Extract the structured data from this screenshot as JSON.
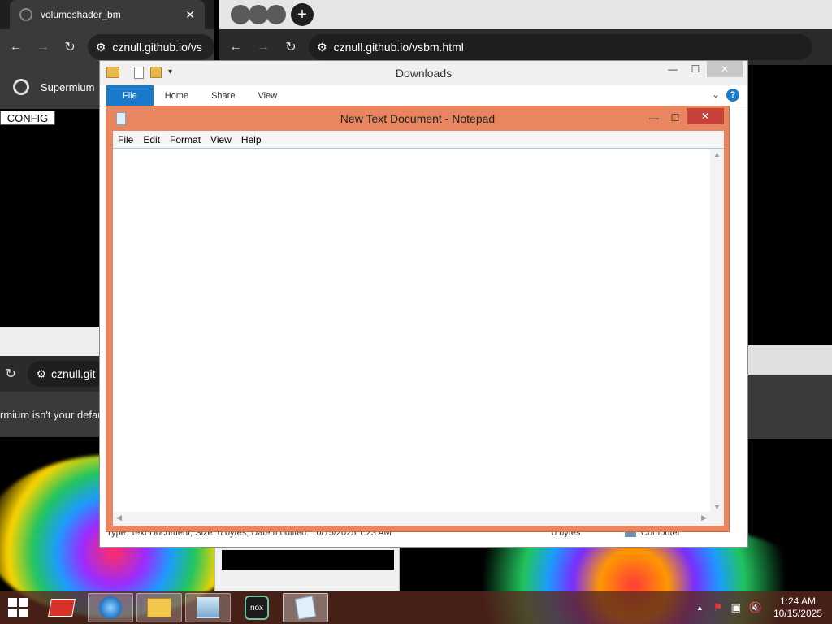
{
  "browser_left": {
    "tab_title": "volumeshader_bm",
    "url": "cznull.github.io/vs",
    "bookmark_label": "Supermium",
    "config_button": "CONFIG"
  },
  "browser_right": {
    "url": "cznull.github.io/vsbm.html"
  },
  "browser_lower": {
    "url": "cznull.git",
    "infobar_text": "rmium isn't your defau"
  },
  "explorer": {
    "title": "Downloads",
    "ribbon_tabs": [
      "File",
      "Home",
      "Share",
      "View"
    ],
    "status_left": "Type: Text Document, Size: 0 bytes, Date modified: 10/15/2025 1:23 AM",
    "status_size": "0 bytes",
    "status_location": "Computer"
  },
  "notepad": {
    "title": "New Text Document - Notepad",
    "menus": [
      "File",
      "Edit",
      "Format",
      "View",
      "Help"
    ],
    "content": ""
  },
  "taskbar": {
    "time": "1:24 AM",
    "date": "10/15/2025",
    "apps": [
      "start-icon",
      "app-red-icon",
      "browser-icon",
      "file-explorer-icon",
      "photos-icon",
      "nox-icon",
      "notepad-icon"
    ],
    "nox_label": "nox"
  },
  "colors": {
    "notepad_frame": "#e9865f",
    "close_button": "#c7423a",
    "file_tab": "#1979ca",
    "taskbar": "#5a281e"
  }
}
